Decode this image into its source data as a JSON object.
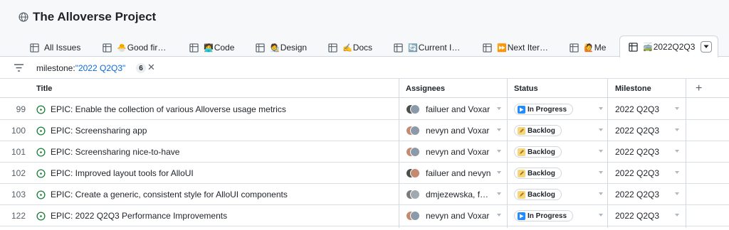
{
  "project": {
    "title": "The Alloverse Project",
    "icon": "globe-icon"
  },
  "tabs": [
    {
      "emoji": "",
      "label": "All Issues"
    },
    {
      "emoji": "🐣",
      "label": "Good fir…"
    },
    {
      "emoji": "🧑‍💻",
      "label": "Code"
    },
    {
      "emoji": "🧑‍🎨",
      "label": "Design"
    },
    {
      "emoji": "✍️",
      "label": "Docs"
    },
    {
      "emoji": "🔄",
      "label": "Current I…"
    },
    {
      "emoji": "⏩",
      "label": "Next Iter…"
    },
    {
      "emoji": "🙋",
      "label": "Me"
    },
    {
      "emoji": "🚎",
      "label": "2022Q2Q3",
      "active": true
    }
  ],
  "filter": {
    "key": "milestone:",
    "value": "\"2022 Q2Q3\"",
    "count": "6",
    "clear": "✕"
  },
  "columns": {
    "title": "Title",
    "assignees": "Assignees",
    "status": "Status",
    "milestone": "Milestone",
    "add": "+"
  },
  "rows": [
    {
      "num": "99",
      "title": "EPIC: Enable the collection of various Alloverse usage metrics",
      "assignees": "failuer and Voxar",
      "status": "In Progress",
      "status_kind": "progress",
      "milestone": "2022 Q2Q3"
    },
    {
      "num": "100",
      "title": "EPIC: Screensharing app",
      "assignees": "nevyn and Voxar",
      "status": "Backlog",
      "status_kind": "backlog",
      "milestone": "2022 Q2Q3"
    },
    {
      "num": "101",
      "title": "EPIC: Screensharing nice-to-have",
      "assignees": "nevyn and Voxar",
      "status": "Backlog",
      "status_kind": "backlog",
      "milestone": "2022 Q2Q3"
    },
    {
      "num": "102",
      "title": "EPIC: Improved layout tools for AlloUI",
      "assignees": "failuer and nevyn",
      "status": "Backlog",
      "status_kind": "backlog",
      "milestone": "2022 Q2Q3"
    },
    {
      "num": "103",
      "title": "EPIC: Create a generic, consistent style for AlloUI components",
      "assignees": "dmjezewska, f…",
      "status": "Backlog",
      "status_kind": "backlog",
      "milestone": "2022 Q2Q3"
    },
    {
      "num": "122",
      "title": "EPIC: 2022 Q2Q3 Performance Improvements",
      "assignees": "nevyn and Voxar",
      "status": "In Progress",
      "status_kind": "progress",
      "milestone": "2022 Q2Q3"
    }
  ],
  "colors": {
    "open_issue": "#1a7f37",
    "link": "#0969da",
    "progress": "#218bff",
    "backlog": "#f5d67a"
  }
}
